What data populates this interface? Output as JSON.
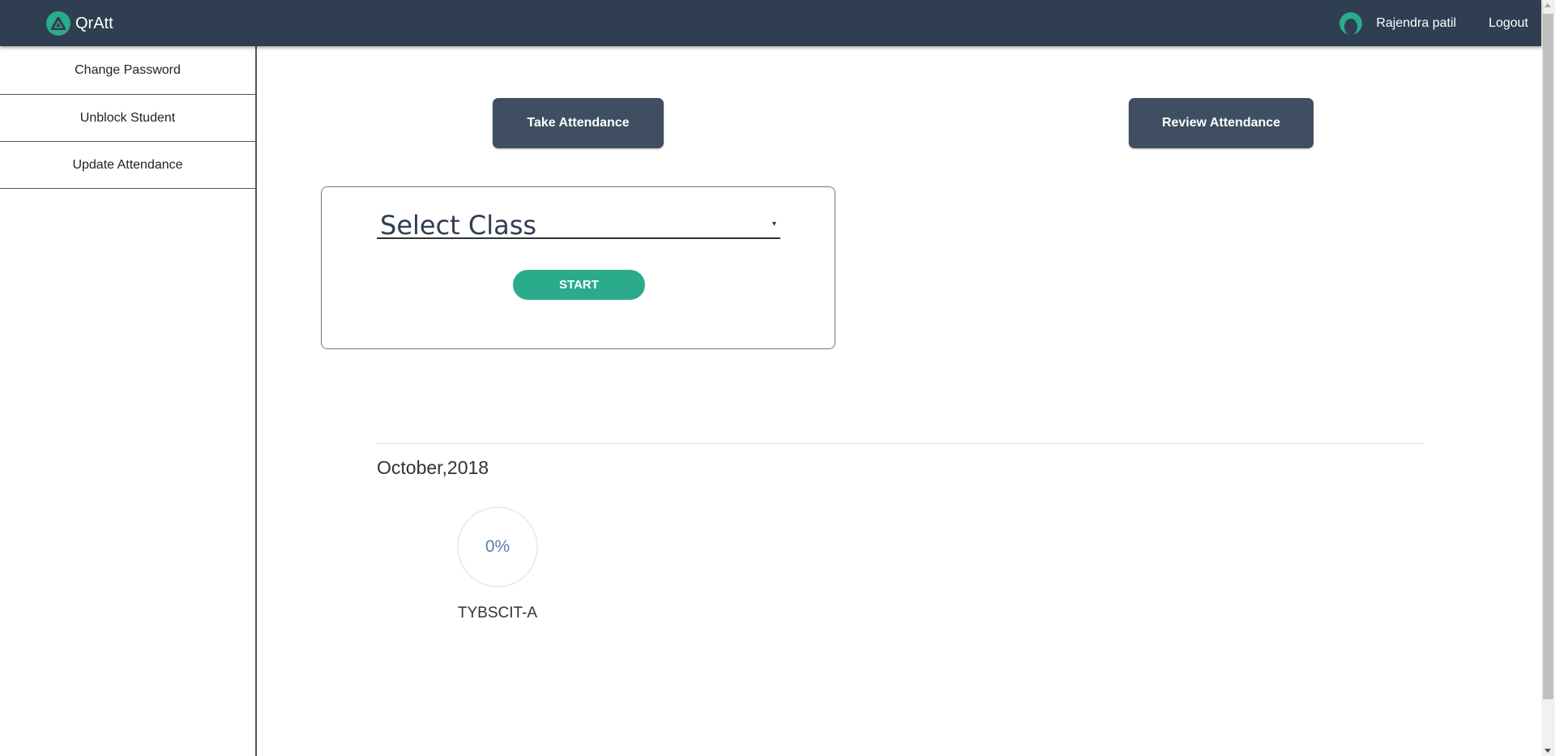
{
  "navbar": {
    "brand": "QrAtt",
    "user_name": "Rajendra patil",
    "logout": "Logout",
    "logo_icon": "triangle-logo-icon",
    "avatar_icon": "user-avatar-icon",
    "bg_color": "#2f3e50",
    "accent_color": "#2aab8c"
  },
  "sidebar": {
    "items": [
      {
        "label": "Change Password"
      },
      {
        "label": "Unblock Student"
      },
      {
        "label": "Update Attendance"
      }
    ]
  },
  "main": {
    "take_attendance": "Take Attendance",
    "review_attendance": "Review Attendance",
    "select_class": {
      "placeholder": "Select Class",
      "arrow": "▾"
    },
    "start": "START",
    "month": "October,2018",
    "classes": [
      {
        "percent": "0%",
        "name": "TYBSCIT-A"
      }
    ]
  }
}
